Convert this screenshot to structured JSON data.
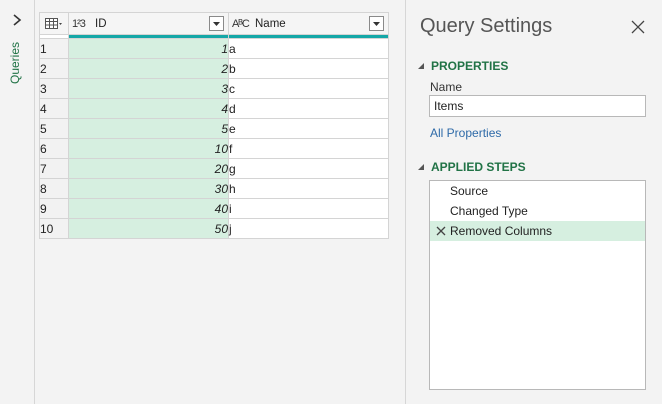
{
  "rail": {
    "label": "Queries"
  },
  "grid": {
    "columns": [
      {
        "type_icon": "1²3",
        "title": "ID"
      },
      {
        "type_icon": "AᴮC",
        "title": "Name"
      }
    ],
    "rows": [
      {
        "num": "1",
        "id": "1",
        "name": "a"
      },
      {
        "num": "2",
        "id": "2",
        "name": "b"
      },
      {
        "num": "3",
        "id": "3",
        "name": "c"
      },
      {
        "num": "4",
        "id": "4",
        "name": "d"
      },
      {
        "num": "5",
        "id": "5",
        "name": "e"
      },
      {
        "num": "6",
        "id": "10",
        "name": "f"
      },
      {
        "num": "7",
        "id": "20",
        "name": "g"
      },
      {
        "num": "8",
        "id": "30",
        "name": "h"
      },
      {
        "num": "9",
        "id": "40",
        "name": "i"
      },
      {
        "num": "10",
        "id": "50",
        "name": "j"
      }
    ]
  },
  "panel": {
    "title": "Query Settings",
    "properties_header": "PROPERTIES",
    "name_label": "Name",
    "name_value": "Items",
    "all_properties_link": "All Properties",
    "applied_steps_header": "APPLIED STEPS",
    "steps": [
      {
        "label": "Source"
      },
      {
        "label": "Changed Type"
      },
      {
        "label": "Removed Columns"
      }
    ]
  },
  "colors": {
    "accent_green": "#217346",
    "selected_bg": "#d6efe0",
    "header_bar": "#15a7a7",
    "link": "#2e6aa8"
  }
}
